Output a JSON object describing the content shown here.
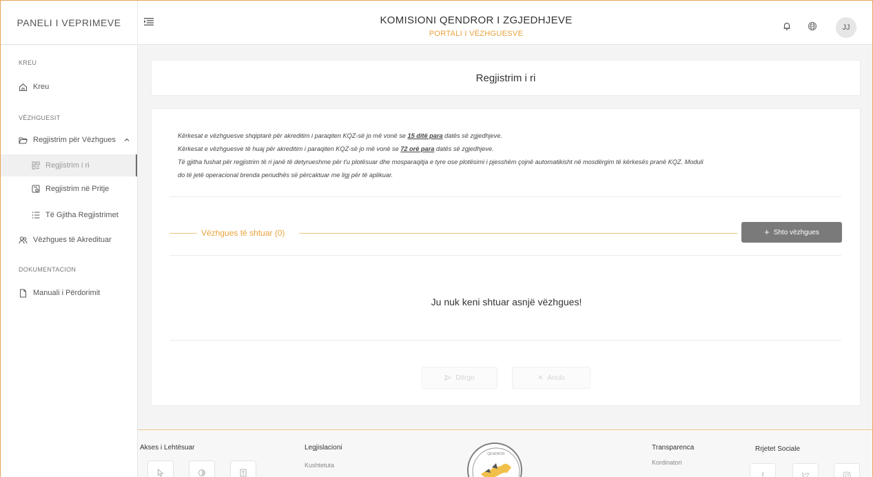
{
  "header": {
    "brand": "PANELI I VEPRIMEVE",
    "title": "KOMISIONI QENDROR I ZGJEDHJEVE",
    "subtitle": "PORTALI I VËZHGUESVE",
    "avatar_initials": "JJ"
  },
  "sidebar": {
    "section_home": "KREU",
    "home": "Kreu",
    "section_observers": "VËZHGUESIT",
    "registration_group": "Regjistrim për Vëzhgues",
    "new_registration": "Regjistrim i ri",
    "pending": "Regjistrim në Pritje",
    "all_registrations": "Të Gjitha Regjistrimet",
    "accredited": "Vëzhgues të Akredituar",
    "section_docs": "DOKUMENTACION",
    "manual": "Manuali i Përdorimit"
  },
  "page": {
    "title": "Regjistrim i ri",
    "info": {
      "line1_a": "Kërkesat e vëzhguesve shqiptarë për akreditim i paraqiten KQZ-së jo më vonë se",
      "line1_b": "15 ditë para",
      "line1_c": "datës së zgjedhjeve.",
      "line2_a": "Kërkesat e vëzhguesve të huaj për akreditim i paraqiten KQZ-së jo më vonë se",
      "line2_b": "72 orë para",
      "line2_c": "datës së zgjedhjeve.",
      "line3": "Të gjitha fushat për regjistrim të ri janë të detyrueshme për t'u plotësuar dhe mosparaqitja e tyre ose plotësimi i pjesshëm çojnë automatikisht në mosdërgim të kërkesës pranë KQZ. Moduli",
      "line4": "do të jetë operacional brenda periudhës së përcaktuar me ligj për të aplikuar."
    },
    "observers_label": "Vëzhgues të shtuar (0)",
    "add_button": "Shto vëzhgues",
    "empty_message": "Ju nuk keni shtuar asnjë vëzhgues!",
    "send_button": "Dërgo",
    "cancel_button": "Anulo"
  },
  "footer": {
    "accessibility": "Akses i Lehtësuar",
    "legislation": "Legjislacioni",
    "constitution": "Kushtetuta",
    "transparency": "Transparenca",
    "coordinator": "Kordinatori",
    "social": "Rrjetet Sociale"
  },
  "colors": {
    "accent": "#e8a23a",
    "frame_border": "#e8a35a",
    "button_gray": "#7a7a7a"
  }
}
